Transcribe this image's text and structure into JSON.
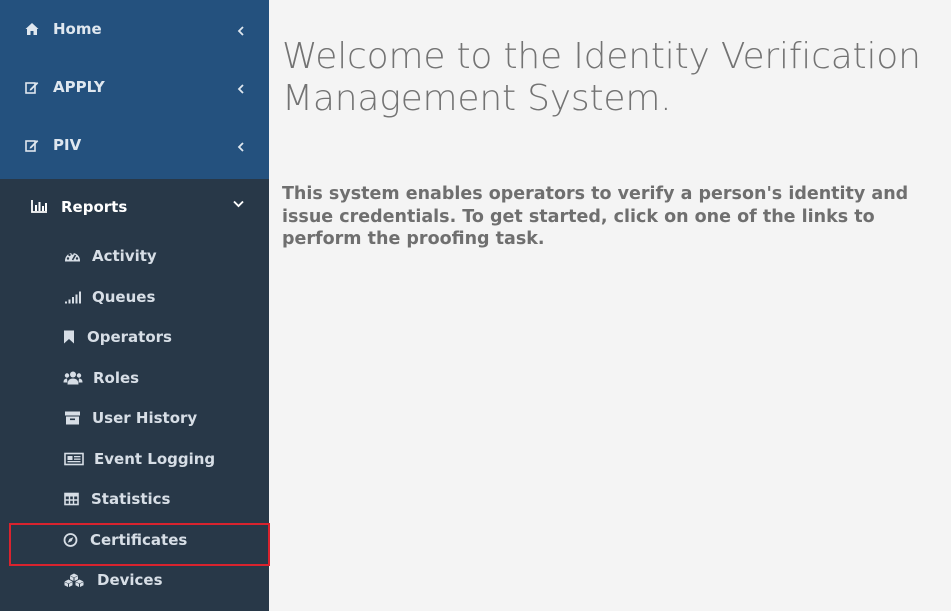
{
  "sidebar": {
    "top_items": [
      {
        "label": "Home",
        "icon": "home-icon"
      },
      {
        "label": "APPLY",
        "icon": "edit-icon"
      },
      {
        "label": "PIV",
        "icon": "edit-icon"
      }
    ],
    "reports": {
      "label": "Reports",
      "icon": "bar-chart-icon",
      "expanded": true,
      "items": [
        {
          "label": "Activity",
          "icon": "dashboard-icon"
        },
        {
          "label": "Queues",
          "icon": "signal-icon"
        },
        {
          "label": "Operators",
          "icon": "bookmark-icon"
        },
        {
          "label": "Roles",
          "icon": "users-icon"
        },
        {
          "label": "User History",
          "icon": "archive-icon"
        },
        {
          "label": "Event Logging",
          "icon": "newspaper-icon"
        },
        {
          "label": "Statistics",
          "icon": "table-icon"
        },
        {
          "label": "Certificates",
          "icon": "compass-icon",
          "highlighted": true
        },
        {
          "label": "Devices",
          "icon": "cubes-icon"
        }
      ]
    }
  },
  "main": {
    "title": "Welcome to the Identity Verification Management System.",
    "intro": "This system enables operators to verify a person's identity and issue credentials. To get started, click on one of the links to perform the proofing task."
  },
  "colors": {
    "top_nav_bg": "#24517e",
    "sidebar_bg": "#283848",
    "page_bg": "#f4f4f4",
    "highlight": "#d9232e"
  }
}
